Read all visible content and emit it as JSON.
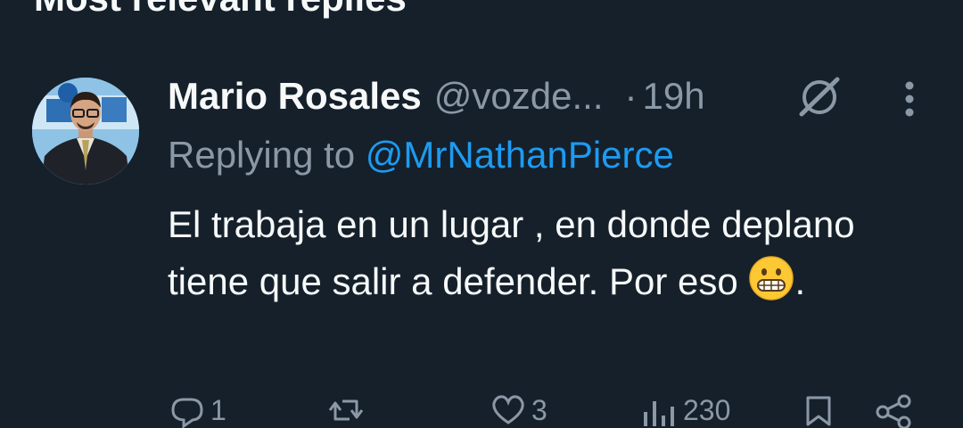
{
  "section_title": "Most relevant replies",
  "tweet": {
    "author_name": "Mario Rosales",
    "handle": "@vozde...",
    "separator": "·",
    "time": "19h",
    "replying_prefix": "Replying to ",
    "replying_to": "@MrNathanPierce",
    "text_main": "El trabaja en un lugar , en donde deplano tiene que salir a defender. Por eso",
    "text_end": ".",
    "emoji": "grimacing-face",
    "icons": {
      "grok": "grok-slash-icon",
      "more": "more-vertical-icon",
      "reply": "reply-icon",
      "retweet": "retweet-icon",
      "like": "like-icon",
      "views": "views-icon",
      "bookmark": "bookmark-icon",
      "share": "share-icon"
    }
  },
  "actions": {
    "reply_count": "1",
    "like_count": "3",
    "views_count": "230"
  },
  "colors": {
    "background": "#15202b",
    "text": "#f7f9f9",
    "muted": "#8b98a5",
    "accent": "#1d9bf0"
  }
}
